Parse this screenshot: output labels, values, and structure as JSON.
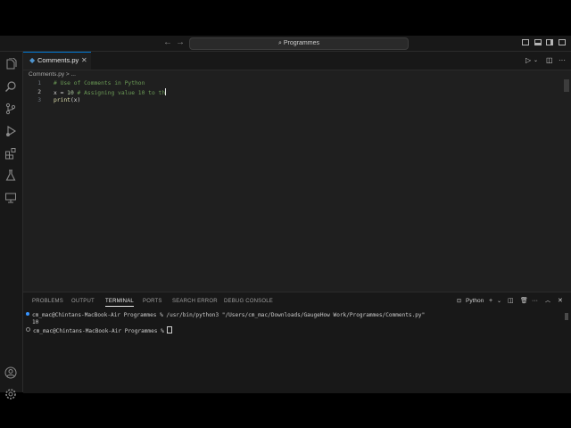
{
  "titlebar": {
    "back_icon": "←",
    "forward_icon": "→",
    "search_text": "Programmes"
  },
  "activity": [
    "explorer-icon",
    "search-icon",
    "source-control-icon",
    "run-debug-icon",
    "extensions-icon",
    "testing-icon",
    "remote-explorer-icon"
  ],
  "activity_bottom": [
    "account-icon",
    "settings-gear-icon"
  ],
  "tab": {
    "label": "Comments.py",
    "close": "✕"
  },
  "breadcrumb": "Comments.py > ...",
  "editor": {
    "lines": [
      {
        "no": "1",
        "code": "# Use of Comments in Python"
      },
      {
        "no": "2",
        "pre": "x = ",
        "num": "10",
        "comment": " # Assigning value 10 to th"
      },
      {
        "no": "3",
        "fn": "print",
        "rest": "(x)"
      }
    ]
  },
  "panel": {
    "tabs": [
      "PROBLEMS",
      "OUTPUT",
      "TERMINAL",
      "PORTS",
      "SEARCH ERROR",
      "DEBUG CONSOLE"
    ],
    "active_tab": "TERMINAL",
    "shell_label": "Python",
    "terminal": {
      "line1": "cm_mac@Chintans-MacBook-Air Programmes % /usr/bin/python3 \"/Users/cm_mac/Downloads/GaugeHow Work/Programmes/Comments.py\"",
      "line2": "10",
      "line3": "cm_mac@Chintans-MacBook-Air Programmes % "
    }
  },
  "colors": {
    "accent": "#0078d4",
    "comment": "#6a9955",
    "number": "#b5cea8",
    "function": "#dcdcaa"
  }
}
